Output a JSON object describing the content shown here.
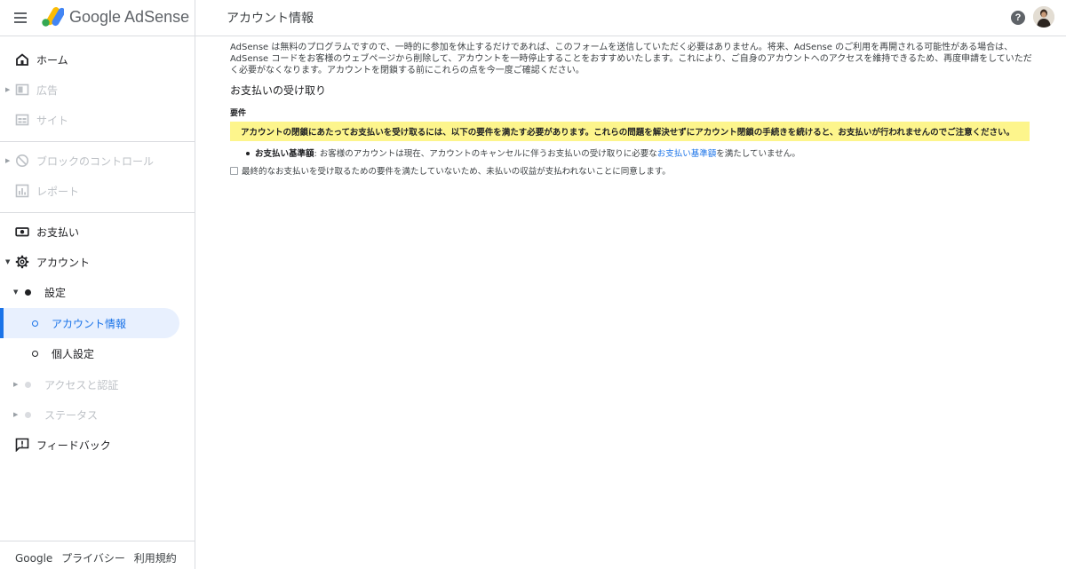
{
  "header": {
    "brand": "Google AdSense",
    "page_title": "アカウント情報",
    "help_glyph": "?"
  },
  "sidebar": {
    "home": "ホーム",
    "ads": "広告",
    "sites": "サイト",
    "blocking": "ブロックのコントロール",
    "reports": "レポート",
    "payments": "お支払い",
    "account": "アカウント",
    "settings": "設定",
    "account_info": "アカウント情報",
    "personal": "個人設定",
    "access": "アクセスと認証",
    "status": "ステータス",
    "feedback": "フィードバック"
  },
  "footer": {
    "google": "Google",
    "privacy": "プライバシー",
    "terms": "利用規約"
  },
  "main": {
    "intro": "AdSense は無料のプログラムですので、一時的に参加を休止するだけであれば、このフォームを送信していただく必要はありません。将来、AdSense のご利用を再開される可能性がある場合は、AdSense コードをお客様のウェブページから削除して、アカウントを一時停止することをおすすめいたします。これにより、ご自身のアカウントへのアクセスを維持できるため、再度申請をしていただく必要がなくなります。アカウントを閉鎖する前にこれらの点を今一度ご確認ください。",
    "section_title": "お支払いの受け取り",
    "requirements_title": "要件",
    "warning": "アカウントの閉鎖にあたってお支払いを受け取るには、以下の要件を満たす必要があります。これらの問題を解決せずにアカウント閉鎖の手続きを続けると、お支払いが行われませんのでご注意ください。",
    "req_label": "お支払い基準額",
    "req_text_before": ": お客様のアカウントは現在、アカウントのキャンセルに伴うお支払いの受け取りに必要な",
    "req_link": "お支払い基準額",
    "req_text_after": "を満たしていません。",
    "agree_text": "最終的なお支払いを受け取るための要件を満たしていないため、未払いの収益が支払われないことに同意します。"
  },
  "colors": {
    "accent": "#1a73e8",
    "warning_bg": "#fdf58c",
    "active_bg": "#e8f0fe"
  }
}
